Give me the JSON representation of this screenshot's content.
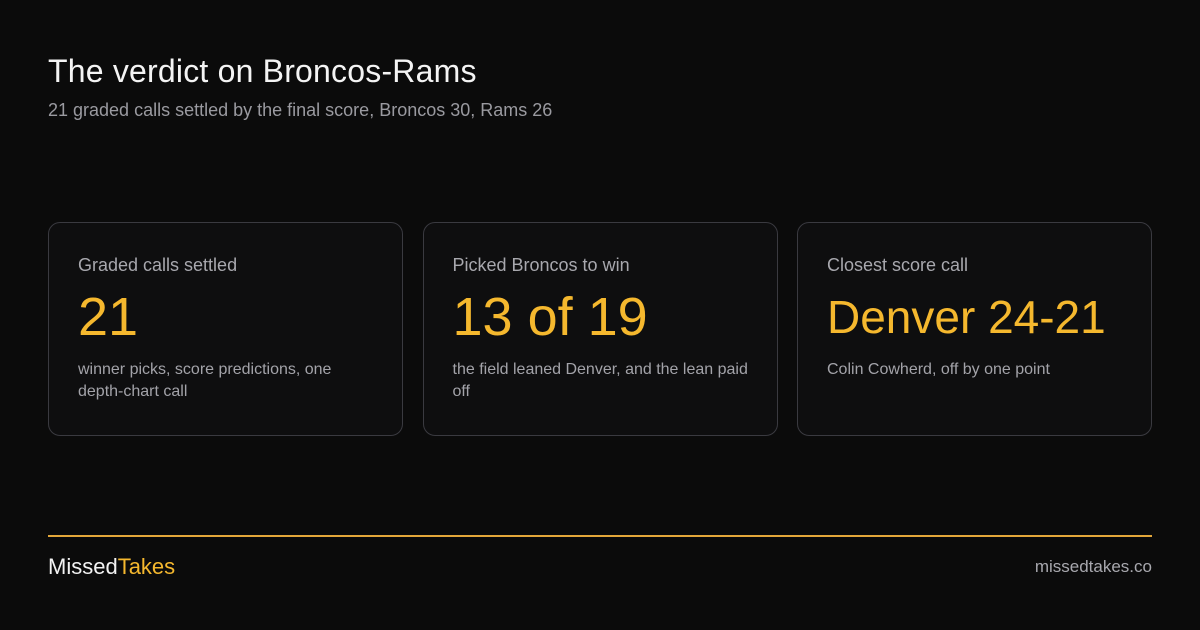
{
  "header": {
    "title": "The verdict on Broncos-Rams",
    "subtitle": "21 graded calls settled by the final score, Broncos 30, Rams 26"
  },
  "cards": [
    {
      "label": "Graded calls settled",
      "value": "21",
      "note": "winner picks, score predictions, one depth-chart call"
    },
    {
      "label": "Picked Broncos to win",
      "value": "13 of 19",
      "note": "the field leaned Denver, and the lean paid off"
    },
    {
      "label": "Closest score call",
      "value": "Denver 24-21",
      "note": "Colin Cowherd, off by one point"
    }
  ],
  "footer": {
    "brand_part1": "Missed",
    "brand_part2": "Takes",
    "site": "missedtakes.co"
  },
  "colors": {
    "background": "#0b0b0b",
    "accent": "#f5b82e",
    "card_border": "#3a3a40",
    "muted_text": "#9a9aa0"
  }
}
